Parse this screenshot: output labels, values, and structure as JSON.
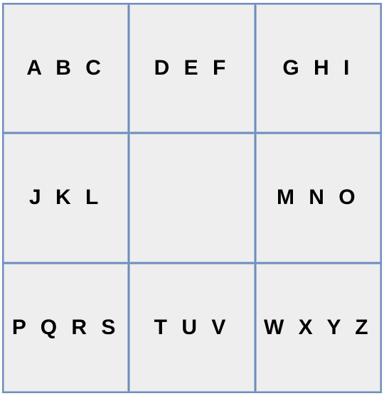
{
  "keypad": {
    "keys": [
      {
        "label": "A B C"
      },
      {
        "label": "D E F"
      },
      {
        "label": "G H I"
      },
      {
        "label": "J K L"
      },
      {
        "label": ""
      },
      {
        "label": "M N O"
      },
      {
        "label": "P Q R S"
      },
      {
        "label": "T U V"
      },
      {
        "label": "W X Y Z"
      }
    ]
  }
}
